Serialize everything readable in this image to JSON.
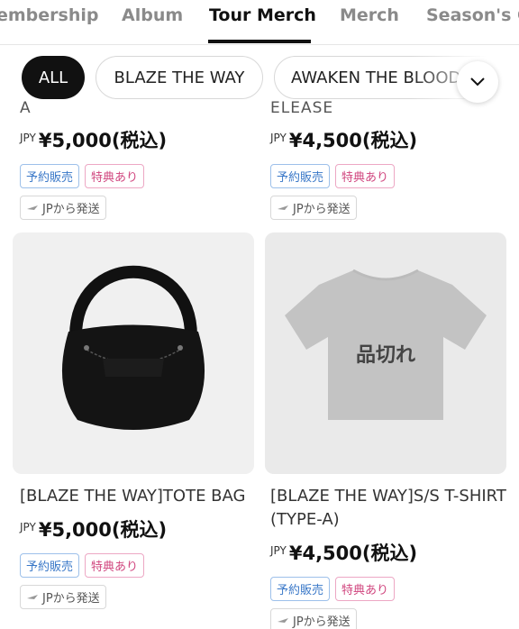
{
  "tabs": [
    {
      "label": "embership",
      "active": false
    },
    {
      "label": "Album",
      "active": false
    },
    {
      "label": "Tour Merch",
      "active": true
    },
    {
      "label": "Merch",
      "active": false
    },
    {
      "label": "Season's G",
      "active": false
    }
  ],
  "filters": {
    "chips": [
      {
        "label": "ALL",
        "active": true
      },
      {
        "label": "BLAZE THE WAY",
        "active": false
      },
      {
        "label": "AWAKEN THE BLOOD",
        "active": false
      }
    ],
    "expand_icon": "chevron-down-icon"
  },
  "products_top": [
    {
      "name_cut": "A",
      "currency": "JPY",
      "price": "¥5,000(税込)",
      "badge_pre": "予約販売",
      "badge_bonus": "特典あり",
      "ship": "JPから発送"
    },
    {
      "name_cut": "ELEASE",
      "currency": "JPY",
      "price": "¥4,500(税込)",
      "badge_pre": "予約販売",
      "badge_bonus": "特典あり",
      "ship": "JPから発送"
    }
  ],
  "products": [
    {
      "name": "[BLAZE THE WAY]TOTE BAG",
      "currency": "JPY",
      "price": "¥5,000(税込)",
      "badge_pre": "予約販売",
      "badge_bonus": "特典あり",
      "ship": "JPから発送",
      "sold_out": false,
      "image": "black-tote-bag"
    },
    {
      "name": "[BLAZE THE WAY]S/S T-SHIRT (TYPE-A)",
      "currency": "JPY",
      "price": "¥4,500(税込)",
      "badge_pre": "予約販売",
      "badge_bonus": "特典あり",
      "ship": "JPから発送",
      "sold_out": true,
      "sold_out_label": "品切れ",
      "image": "gray-t-shirt"
    }
  ],
  "colors": {
    "active_chip": "#111111",
    "pre_badge": "#3a78c8",
    "bonus_badge": "#d0457e"
  }
}
